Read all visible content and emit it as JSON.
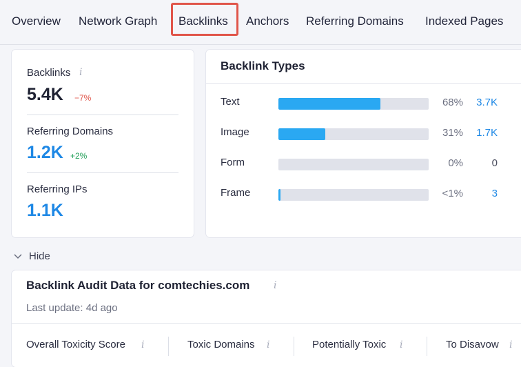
{
  "tabs": [
    {
      "label": "Overview"
    },
    {
      "label": "Network Graph"
    },
    {
      "label": "Backlinks"
    },
    {
      "label": "Anchors"
    },
    {
      "label": "Referring Domains"
    },
    {
      "label": "Indexed Pages"
    }
  ],
  "selected_tab": "Backlinks",
  "metrics": {
    "backlinks": {
      "label": "Backlinks",
      "value": "5.4K",
      "delta": "−7%"
    },
    "referring_domains": {
      "label": "Referring Domains",
      "value": "1.2K",
      "delta": "+2%"
    },
    "referring_ips": {
      "label": "Referring IPs",
      "value": "1.1K"
    }
  },
  "backlink_types": {
    "title": "Backlink Types",
    "rows": [
      {
        "label": "Text",
        "share": 0.68,
        "percent": "68%",
        "count": "3.7K"
      },
      {
        "label": "Image",
        "share": 0.31,
        "percent": "31%",
        "count": "1.7K"
      },
      {
        "label": "Form",
        "share": 0,
        "percent": "0%",
        "count": "0"
      },
      {
        "label": "Frame",
        "share": 0.01,
        "percent": "<1%",
        "count": "3"
      }
    ]
  },
  "hide_toggle": {
    "label": "Hide"
  },
  "audit": {
    "title": "Backlink Audit Data for comtechies.com",
    "last_update": "Last update: 4d ago",
    "columns": [
      {
        "label": "Overall Toxicity Score"
      },
      {
        "label": "Toxic Domains"
      },
      {
        "label": "Potentially Toxic"
      },
      {
        "label": "To Disavow"
      }
    ]
  },
  "colors": {
    "accent_blue": "#1e88e5",
    "bar_fill": "#2aa8f2",
    "bar_track": "#e0e2ea",
    "negative": "#e0554a",
    "positive": "#23a05a",
    "highlight_box": "#e0554a"
  },
  "icons": {
    "info": "info-icon",
    "chevron": "chevron-down-icon"
  }
}
